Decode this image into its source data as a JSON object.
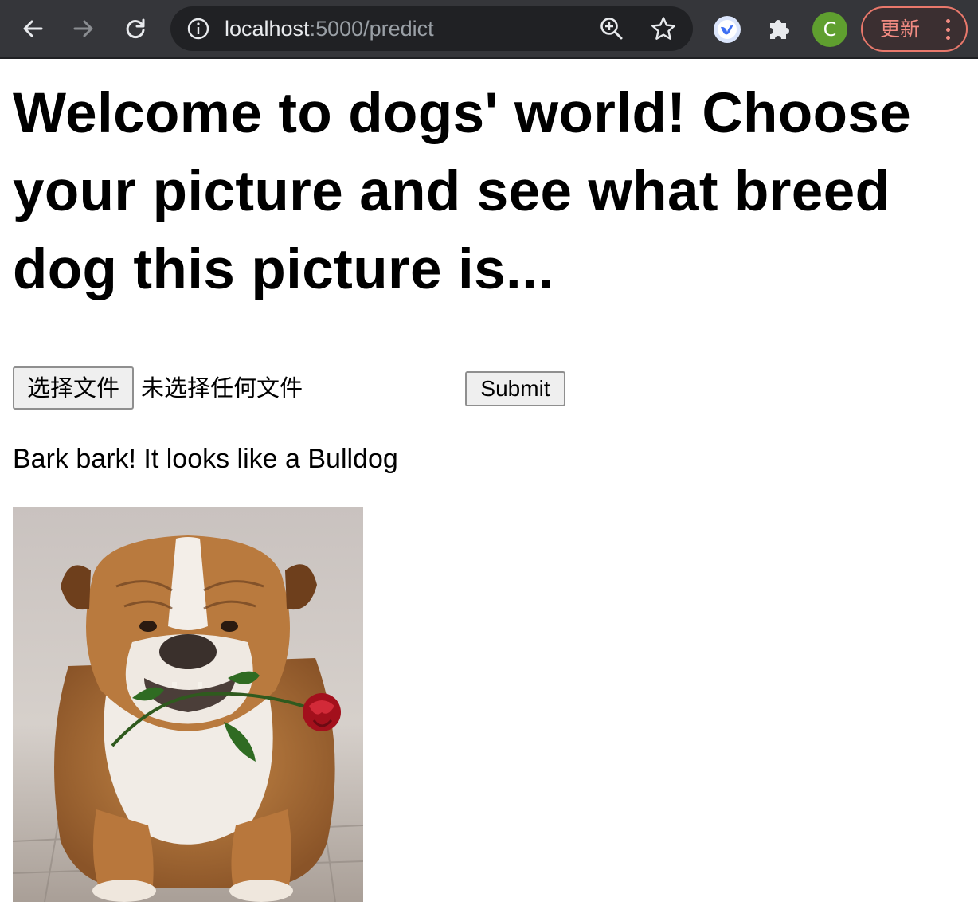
{
  "browser": {
    "url_host": "localhost",
    "url_path": ":5000/predict",
    "avatar_letter": "C",
    "update_label": "更新",
    "icons": {
      "back": "arrow-left-icon",
      "forward": "arrow-right-icon",
      "reload": "reload-icon",
      "site_info": "info-icon",
      "zoom": "zoom-in-icon",
      "bookmark": "star-icon",
      "extension_bird": "bird-extension-icon",
      "extensions": "puzzle-icon",
      "menu": "kebab-menu-icon"
    },
    "colors": {
      "toolbar": "#35363a",
      "omnibox": "#202124",
      "avatar": "#5f9f2f",
      "update_accent": "#f28b82"
    }
  },
  "page": {
    "heading": "Welcome to dogs' world! Choose your picture and see what breed dog this picture is...",
    "upload": {
      "choose_label": "选择文件",
      "status": "未选择任何文件"
    },
    "submit_label": "Submit",
    "result_text": "Bark bark! It looks like a Bulldog"
  }
}
